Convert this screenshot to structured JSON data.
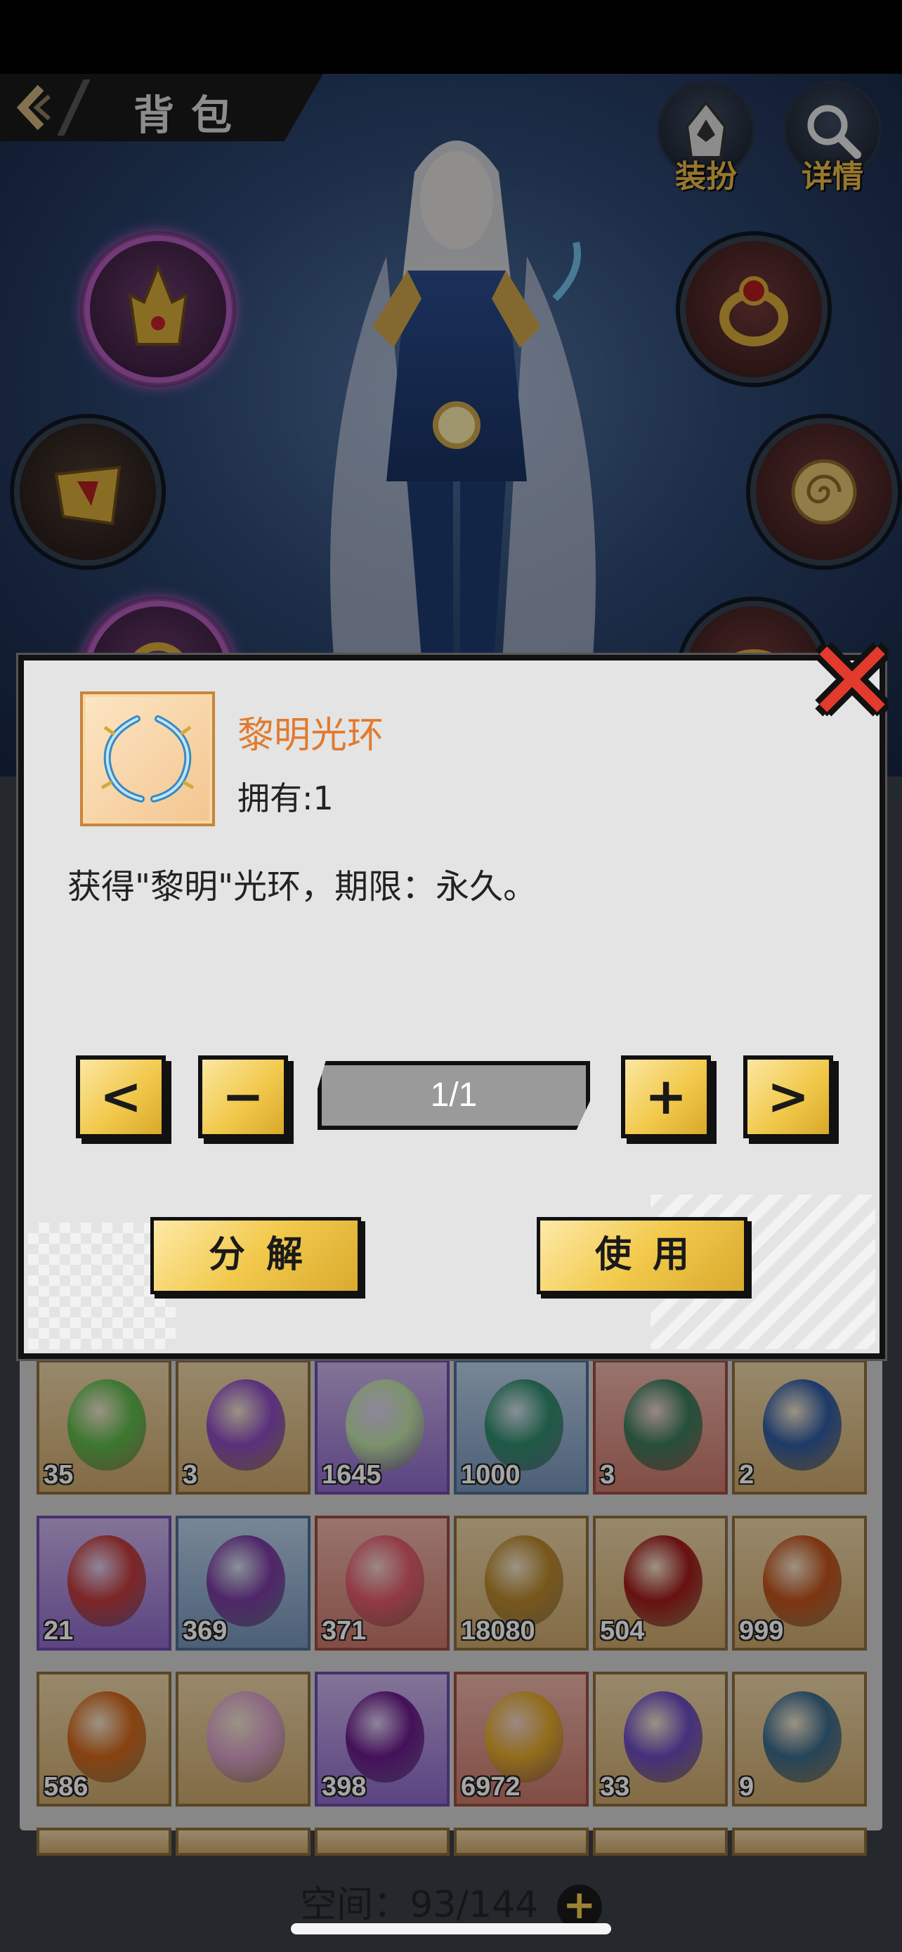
{
  "header": {
    "title": "背包",
    "back_icon": "chevron-left-icon"
  },
  "top_actions": [
    {
      "label": "装扮",
      "icon": "hooded-figure-icon"
    },
    {
      "label": "详情",
      "icon": "magnifier-icon"
    }
  ],
  "equipment_slots": [
    {
      "icon": "crown-icon",
      "rarity": "purple"
    },
    {
      "icon": "shoulder-armor-icon",
      "rarity": "normal"
    },
    {
      "icon": "necklace-icon",
      "rarity": "purple"
    },
    {
      "icon": "ring-icon",
      "rarity": "red"
    },
    {
      "icon": "spiral-charm-icon",
      "rarity": "red"
    },
    {
      "icon": "bracelet-icon",
      "rarity": "red"
    }
  ],
  "dialog": {
    "item_name": "黎明光环",
    "owned_label": "拥有:1",
    "description": "获得\"黎明\"光环，期限：永久。",
    "page_indicator": "1/1",
    "prev_label": "<",
    "minus_label": "−",
    "plus_label": "+",
    "next_label": ">",
    "decompose_label": "分解",
    "use_label": "使用",
    "close_label": "✕",
    "colors": {
      "item_name": "#e27a2e",
      "button_gold": "#f2c94c",
      "close_red": "#e23a2c"
    }
  },
  "inventory": {
    "items": [
      {
        "count": "35",
        "rarity": "gold",
        "icon": "green-potion-icon",
        "color": "#5cb84a"
      },
      {
        "count": "3",
        "rarity": "gold",
        "icon": "purple-potion-icon",
        "color": "#8a4ac0"
      },
      {
        "count": "1645",
        "rarity": "purple",
        "icon": "banknote-icon",
        "color": "#bfe0a8"
      },
      {
        "count": "1000",
        "rarity": "blue",
        "icon": "jade-gem-icon",
        "color": "#2e8a6a"
      },
      {
        "count": "3",
        "rarity": "red",
        "icon": "sweep-scroll-icon",
        "color": "#3a7a5a"
      },
      {
        "count": "2",
        "rarity": "gold",
        "icon": "guide-scroll-icon",
        "color": "#2e5aa0"
      },
      {
        "count": "21",
        "rarity": "purple",
        "icon": "red-scroll-icon",
        "color": "#c03a3a"
      },
      {
        "count": "369",
        "rarity": "blue",
        "icon": "purple-scroll-icon",
        "color": "#7a3aa0"
      },
      {
        "count": "371",
        "rarity": "red",
        "icon": "red-orb-icon",
        "color": "#e05a6a"
      },
      {
        "count": "18080",
        "rarity": "gold",
        "icon": "gold-nugget-icon",
        "color": "#b8862a"
      },
      {
        "count": "504",
        "rarity": "gold",
        "icon": "crimson-orb-icon",
        "color": "#a01a1a"
      },
      {
        "count": "999",
        "rarity": "gold",
        "icon": "amber-orb-icon",
        "color": "#c0501a"
      },
      {
        "count": "586",
        "rarity": "gold",
        "icon": "orange-orb-icon",
        "color": "#d0661a"
      },
      {
        "count": "",
        "rarity": "gold",
        "icon": "pink-pearl-icon",
        "color": "#d8a0c8"
      },
      {
        "count": "398",
        "rarity": "purple",
        "icon": "violet-orb-icon",
        "color": "#6a1a8a"
      },
      {
        "count": "6972",
        "rarity": "red",
        "icon": "golden-drop-icon",
        "color": "#e0a82a"
      },
      {
        "count": "33",
        "rarity": "gold",
        "icon": "cosmic-orb-icon",
        "color": "#6a4ac0"
      },
      {
        "count": "9",
        "rarity": "gold",
        "icon": "meditation-card-icon",
        "color": "#3a6a8a"
      }
    ],
    "capacity_label": "空间：93/144"
  }
}
